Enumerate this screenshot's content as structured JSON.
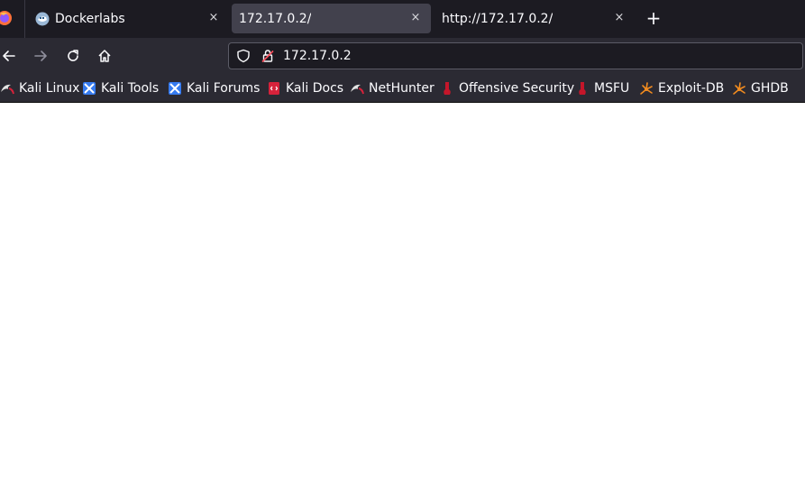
{
  "tabs": [
    {
      "label": "Dockerlabs",
      "active": false,
      "icon": "dockerlabs-favicon-icon"
    },
    {
      "label": "172.17.0.2/",
      "active": true
    },
    {
      "label": "http://172.17.0.2/",
      "active": false
    }
  ],
  "tab_close_glyph": "×",
  "new_tab_glyph": "+",
  "url_bar": {
    "value": "172.17.0.2"
  },
  "bookmarks": [
    {
      "label": "Kali Linux",
      "icon": "kali-dragon-icon"
    },
    {
      "label": "Kali Tools",
      "icon": "kali-tools-icon"
    },
    {
      "label": "Kali Forums",
      "icon": "kali-forums-icon"
    },
    {
      "label": "Kali Docs",
      "icon": "kali-docs-icon"
    },
    {
      "label": "NetHunter",
      "icon": "nethunter-icon"
    },
    {
      "label": "Offensive Security",
      "icon": "offsec-icon"
    },
    {
      "label": "MSFU",
      "icon": "msfu-icon"
    },
    {
      "label": "Exploit-DB",
      "icon": "exploit-db-icon"
    },
    {
      "label": "GHDB",
      "icon": "ghdb-icon"
    }
  ],
  "colors": {
    "tab_strip": "#1c1b22",
    "toolbar": "#2b2a33",
    "active_tab": "#42414d",
    "text": "#fbfbfe",
    "page": "#ffffff"
  }
}
